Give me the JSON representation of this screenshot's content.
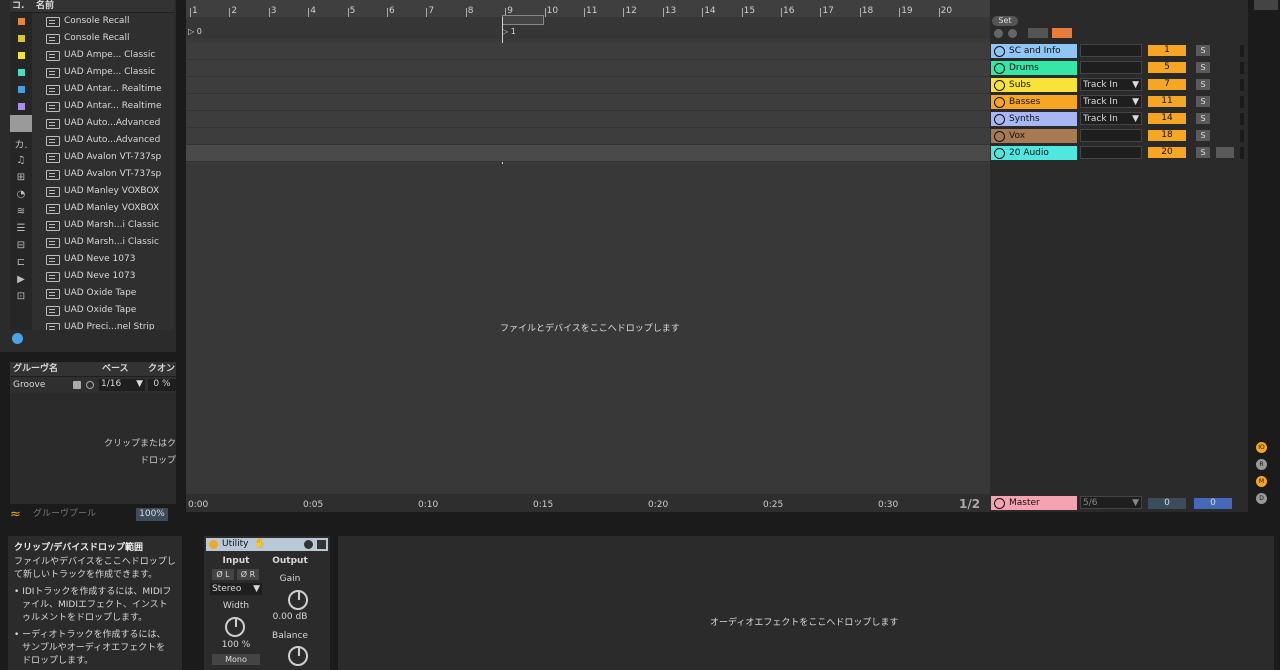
{
  "browser": {
    "cat_header": "コ.",
    "name_header": "名前",
    "items": [
      "Console Recall",
      "Console Recall",
      "UAD Ampe... Classic",
      "UAD Ampe... Classic",
      "UAD Antar... Realtime",
      "UAD Antar... Realtime",
      "UAD Auto...Advanced",
      "UAD Auto...Advanced",
      "UAD Avalon VT-737sp",
      "UAD Avalon VT-737sp",
      "UAD Manley VOXBOX",
      "UAD Manley VOXBOX",
      "UAD Marsh...i Classic",
      "UAD Marsh...i Classic",
      "UAD Neve 1073",
      "UAD Neve 1073",
      "UAD Oxide Tape",
      "UAD Oxide Tape",
      "UAD Preci...nel Strip"
    ],
    "color_squares": [
      "#e8843a",
      "#d9c440",
      "#f2e13b",
      "#4fd9c1",
      "#4a9fe0",
      "#a98de8",
      "#9a9a9a"
    ],
    "cat_label": "カ."
  },
  "groove": {
    "headers": [
      "グルーヴ名",
      "ベース",
      "クオン"
    ],
    "row": {
      "name": "Groove",
      "base": "1/16",
      "quant": "0 %"
    },
    "drop_hint": [
      "クリップまたはク",
      "ドロップ"
    ],
    "footer_label": "グルーヴプール",
    "footer_value": "100%"
  },
  "arrangement": {
    "bars": [
      "1",
      "2",
      "3",
      "4",
      "5",
      "6",
      "7",
      "8",
      "9",
      "10",
      "11",
      "12",
      "13",
      "14",
      "15",
      "16",
      "17",
      "18",
      "19",
      "20"
    ],
    "loop_marker_left": "0",
    "loop_marker_right": "1",
    "drop_text": "ファイルとデバイスをここへドロップします",
    "timecodes": [
      "0:00",
      "0:05",
      "0:10",
      "0:15",
      "0:20",
      "0:25",
      "0:30"
    ],
    "page_indicator": "1/2"
  },
  "mixer": {
    "set_label": "Set",
    "tracks": [
      {
        "name": "SC and Info",
        "color": "#8ec6f5",
        "route": "",
        "num": "1",
        "icon": "list-icon"
      },
      {
        "name": "Drums",
        "color": "#35e6a7",
        "route": "",
        "num": "5",
        "icon": "list-icon"
      },
      {
        "name": "Subs",
        "color": "#f8e33b",
        "route": "Track In",
        "num": "7",
        "icon": "list-icon"
      },
      {
        "name": "Basses",
        "color": "#f6a623",
        "route": "Track In",
        "num": "11",
        "icon": "list-icon"
      },
      {
        "name": "Synths",
        "color": "#a7b6f5",
        "route": "Track In",
        "num": "14",
        "icon": "list-icon"
      },
      {
        "name": "Vox",
        "color": "#a67a55",
        "route": "",
        "num": "18",
        "icon": "list-icon"
      },
      {
        "name": "20 Audio",
        "color": "#4fe8e0",
        "route": "",
        "num": "20",
        "icon": "play-icon"
      }
    ],
    "solo_label": "S",
    "master": {
      "name": "Master",
      "color": "#f5a3b0",
      "route": "5/6",
      "vol_left": "0",
      "vol_right": "0"
    }
  },
  "info_panel": {
    "title": "クリップ/デバイスドロップ範囲",
    "lines": [
      "ファイルやデバイスをここへドロップし",
      "て新しいトラックを作成できます。",
      "• IDIトラックを作成するには、MIDIフ",
      "ァイル、MIDIエフェクト、インスト",
      "ゥルメントをドロップします。",
      "• ーディオトラックを作成するには、",
      "サンプルやオーディオエフェクトを",
      "ドロップします。"
    ]
  },
  "utility": {
    "title": "Utility",
    "input_label": "Input",
    "output_label": "Output",
    "phase_l": "Ø L",
    "phase_r": "Ø R",
    "stereo_mode": "Stereo",
    "width_label": "Width",
    "width_value": "100 %",
    "mono_label": "Mono",
    "gain_label": "Gain",
    "gain_value": "0.00 dB",
    "balance_label": "Balance"
  },
  "fx_drop_text": "オーディオエフェクトをここへドロップします",
  "right_side_letters": [
    "IO",
    "R",
    "M",
    "D"
  ],
  "colors": {
    "accent": "#f6a623",
    "bg": "#1b1b1b"
  }
}
